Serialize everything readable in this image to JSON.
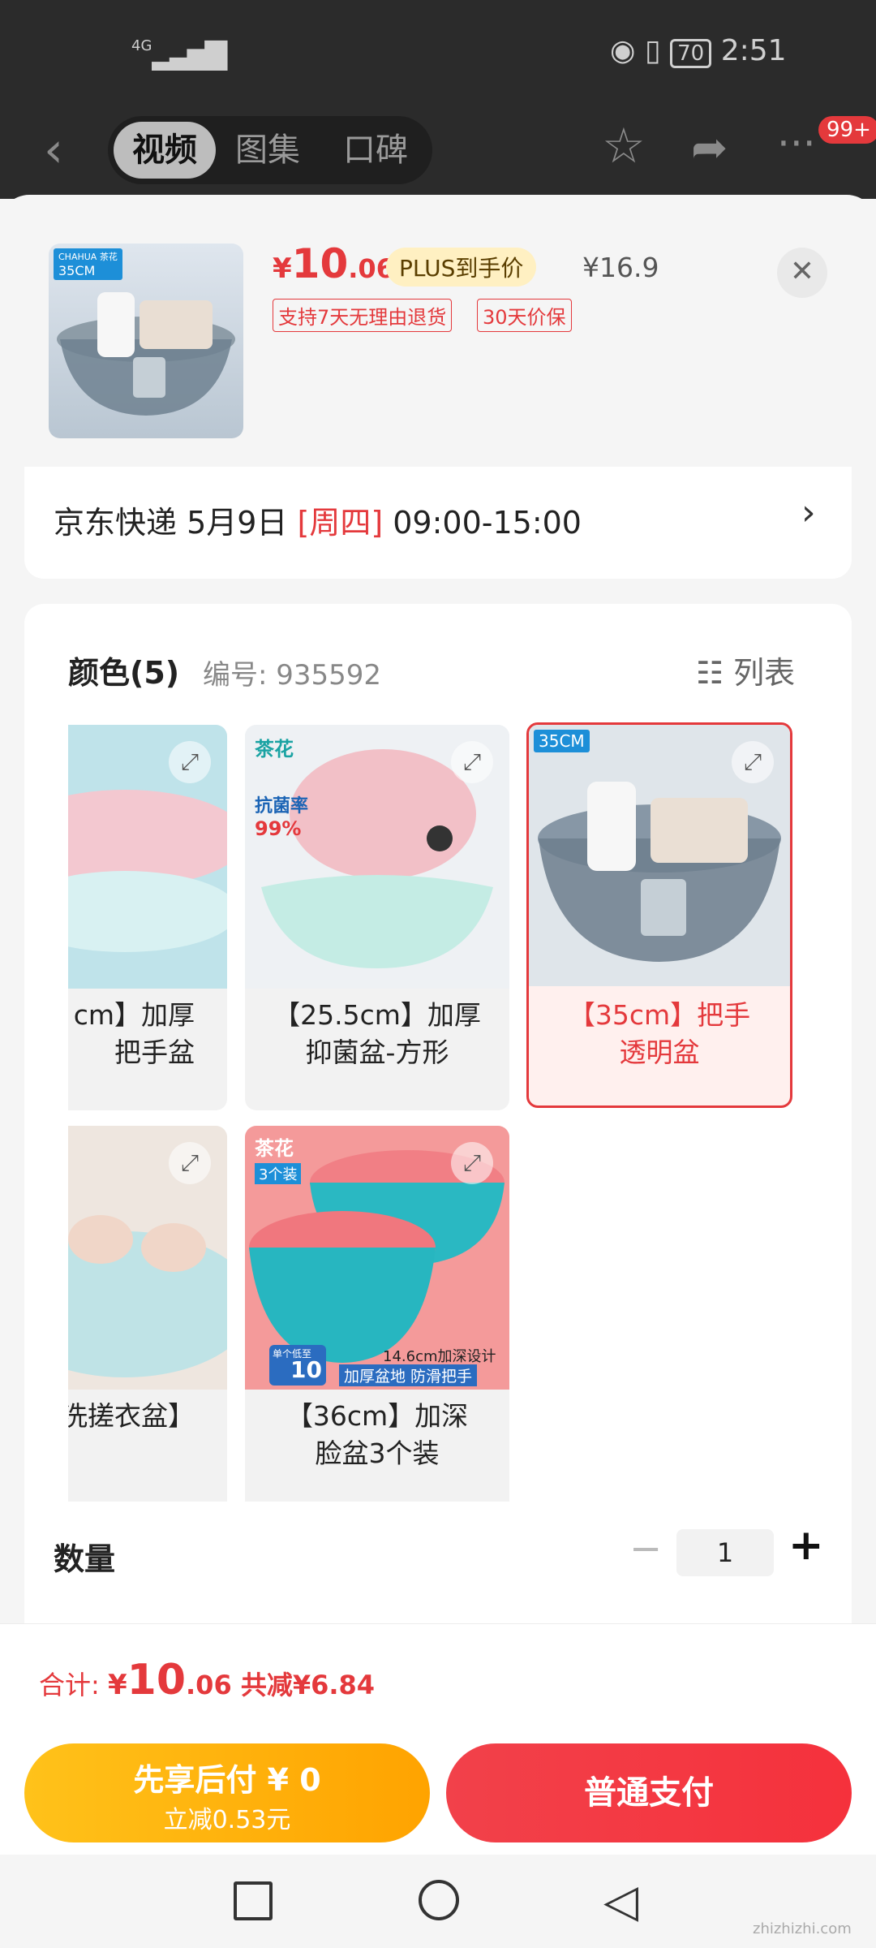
{
  "status_bar": {
    "network": "4G",
    "time": "2:51",
    "battery": "70"
  },
  "top_nav": {
    "tabs": [
      {
        "label": "视频",
        "active": true
      },
      {
        "label": "图集"
      },
      {
        "label": "口碑"
      }
    ],
    "badge": "99+"
  },
  "product": {
    "thumb_badge": "35CM",
    "thumb_brand": "CHAHUA 茶花",
    "price_symbol": "¥",
    "price_int": "10",
    "price_dec": ".06",
    "plus_label": "PLUS到手价",
    "original_price": "¥16.9",
    "tags": [
      "支持7天无理由退货",
      "30天价保"
    ]
  },
  "delivery": {
    "text_main": "京东快递 5月9日 ",
    "weekday": "[周四]",
    "time_range": " 09:00-15:00"
  },
  "color_section": {
    "title": "颜色(5)",
    "code": "编号: 935592",
    "view_label": "列表",
    "options": [
      {
        "line1": "cm】加厚",
        "line2": "把手盆"
      },
      {
        "line1": "【25.5cm】加厚",
        "line2": "抑菌盆-方形",
        "img_badge": "抗菌率",
        "img_pct": "99%",
        "brand": "茶花"
      },
      {
        "line1": "【35cm】把手",
        "line2": "透明盆",
        "selected": true,
        "img_badge": "35CM"
      },
      {
        "line1": "洗搓衣盆】",
        "line2": ""
      },
      {
        "line1": "【36cm】加深",
        "line2": "脸盆3个装",
        "brand": "茶花",
        "pack": "3个装",
        "design": "14.6cm加深设计",
        "feature": "加厚盆地 防滑把手",
        "unit_price_label": "单个低至",
        "unit_price": "10"
      }
    ]
  },
  "quantity": {
    "label": "数量",
    "value": "1",
    "minus": "−",
    "plus": "+"
  },
  "total": {
    "prefix": "合计: ",
    "symbol": "¥",
    "int": "10",
    "dec": ".06",
    "discount": " 共减¥6.84"
  },
  "buttons": {
    "later_pay_title": "先享后付 ¥ 0",
    "later_pay_sub": "立减0.53元",
    "pay_normal": "普通支付"
  },
  "watermark": "zhizhizhi.com",
  "colors": {
    "accent": "#e4393c",
    "yellow": "#ffb400",
    "plus_bg": "#fff0c2"
  }
}
